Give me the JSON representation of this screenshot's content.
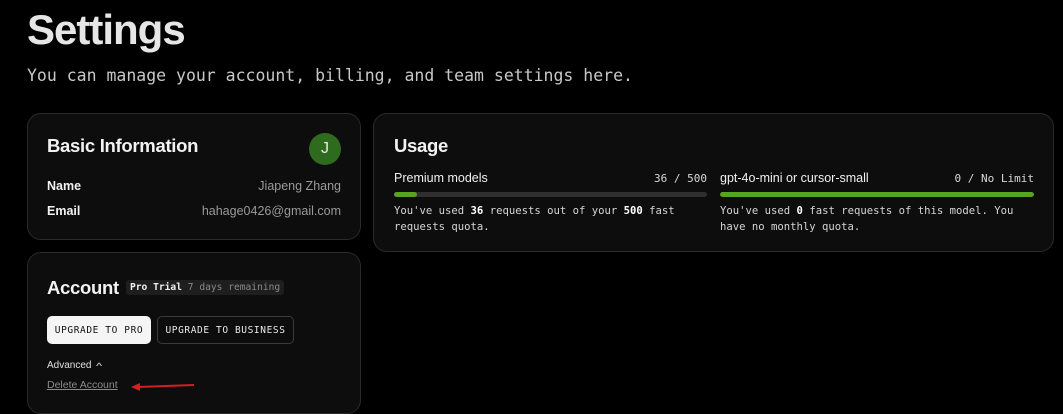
{
  "page": {
    "title": "Settings",
    "subtitle": "You can manage your account, billing, and team settings here."
  },
  "basic": {
    "title": "Basic Information",
    "avatar_initial": "J",
    "avatar_color": "#2e6b1f",
    "name_label": "Name",
    "name_value": "Jiapeng Zhang",
    "email_label": "Email",
    "email_value": "hahage0426@gmail.com"
  },
  "usage": {
    "title": "Usage",
    "bar_color": "#5aa31f",
    "premium": {
      "name": "Premium models",
      "count_text": "36 / 500",
      "used": 36,
      "limit": 500,
      "fill_fraction": 0.072,
      "desc_pre": "You've used ",
      "desc_used": "36",
      "desc_mid": " requests out of your ",
      "desc_limit": "500",
      "desc_post": " fast requests quota."
    },
    "mini": {
      "name": "gpt-4o-mini or cursor-small",
      "count_text": "0 / No Limit",
      "fill_fraction": 1.0,
      "desc_pre": "You've used ",
      "desc_used": "0",
      "desc_post": " fast requests of this model. You have no monthly quota."
    }
  },
  "account": {
    "title": "Account",
    "plan_name": "Pro Trial",
    "plan_remaining": "7 days remaining",
    "upgrade_pro_label": "UPGRADE TO PRO",
    "upgrade_business_label": "UPGRADE TO BUSINESS",
    "advanced_label": "Advanced",
    "advanced_icon": "chevron-up-icon",
    "delete_label": "Delete Account"
  },
  "annotation": {
    "arrow_color": "#d21f1f",
    "arrow_icon": "red-arrow-icon"
  }
}
